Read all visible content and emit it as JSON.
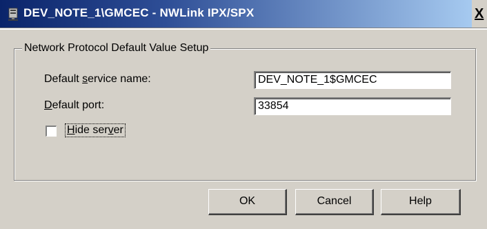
{
  "window": {
    "title": "DEV_NOTE_1\\GMCEC - NWLink IPX/SPX",
    "close_glyph": "X"
  },
  "group": {
    "legend": "Network Protocol Default Value Setup"
  },
  "fields": {
    "service_name": {
      "label_before": "Default ",
      "label_accel": "s",
      "label_after": "ervice name:",
      "value": "DEV_NOTE_1$GMCEC"
    },
    "port": {
      "label_accel": "D",
      "label_after": "efault port:",
      "value": "33854"
    }
  },
  "hide_server": {
    "label_accel": "H",
    "label_mid": "ide ser",
    "label_accel2": "v",
    "label_after": "er",
    "checked": false
  },
  "buttons": {
    "ok": "OK",
    "cancel": "Cancel",
    "help": "Help"
  }
}
